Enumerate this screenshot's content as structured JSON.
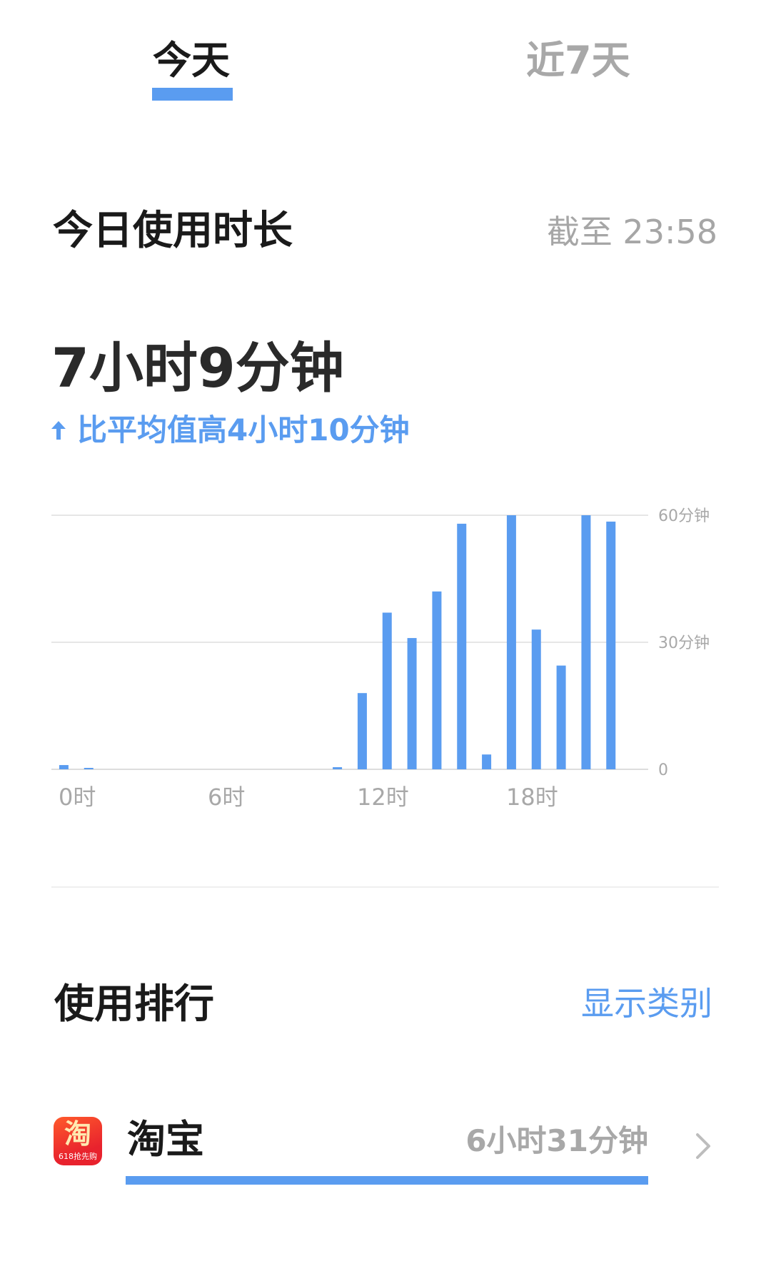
{
  "tabs": {
    "today": "今天",
    "week": "近7天",
    "active": "today"
  },
  "usage": {
    "title": "今日使用时长",
    "as_of": "截至 23:58",
    "total": "7小时9分钟",
    "compare": "比平均值高4小时10分钟"
  },
  "chart_data": {
    "type": "bar",
    "x": [
      0,
      1,
      2,
      3,
      4,
      5,
      6,
      7,
      8,
      9,
      10,
      11,
      12,
      13,
      14,
      15,
      16,
      17,
      18,
      19,
      20,
      21,
      22,
      23
    ],
    "values": [
      1,
      0.3,
      0,
      0,
      0,
      0,
      0,
      0,
      0,
      0,
      0,
      0.5,
      18,
      37,
      31,
      42,
      58,
      3.5,
      60,
      33,
      24.5,
      60,
      58.5,
      0
    ],
    "x_tick_labels": [
      "0时",
      "6时",
      "12时",
      "18时"
    ],
    "x_tick_positions": [
      0,
      6,
      12,
      18
    ],
    "y_tick_labels": [
      "60分钟",
      "30分钟",
      "0"
    ],
    "y_tick_values": [
      60,
      30,
      0
    ],
    "ylim": [
      0,
      60
    ],
    "grid": true,
    "color": "#5a9cf0"
  },
  "ranking": {
    "title": "使用排行",
    "show_category": "显示类别",
    "apps": [
      {
        "name": "淘宝",
        "duration": "6小时31分钟",
        "icon_glyph": "淘",
        "icon_promo": "618抢先购",
        "share": 1.0
      }
    ]
  },
  "colors": {
    "accent": "#5a9cf0",
    "muted": "#a8a8a8",
    "grid": "#e6e6e6"
  }
}
